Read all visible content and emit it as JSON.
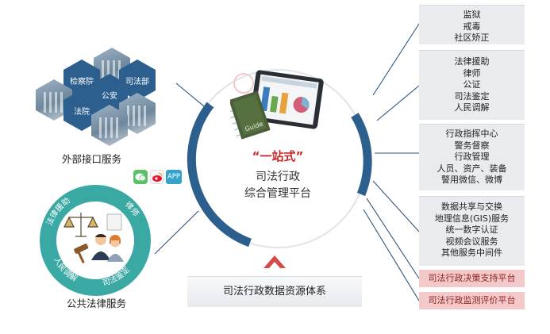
{
  "left": {
    "hex_labels": {
      "procuratorate": "检察院",
      "judicial": "司法部",
      "police": "公安",
      "court": "法院"
    },
    "external_label": "外部接口服务",
    "public_label": "公共法律服务",
    "ring_labels": {
      "legal_aid": "法律援助",
      "lawyer": "律师",
      "mediation": "人民调解",
      "appraisal": "司法鉴定"
    }
  },
  "center": {
    "slogan": "“一站式”",
    "title_line1": "司法行政",
    "title_line2": "综合管理平台",
    "book_text": "Guide"
  },
  "bottom": {
    "system_label": "司法行政数据资源体系"
  },
  "icons": {
    "app_label": "APP"
  },
  "right": {
    "box1": [
      "监狱",
      "戒毒",
      "社区矫正"
    ],
    "box2": [
      "法律援助",
      "律师",
      "公证",
      "司法鉴定",
      "人民调解"
    ],
    "box3": [
      "行政指挥中心",
      "警务督察",
      "行政管理",
      "人员、资产、装备",
      "警用微信、微博"
    ],
    "box4": [
      "数据共享与交换",
      "地理信息(GIS)服务",
      "统一数字认证",
      "视频会议服务",
      "其他服务中间件"
    ],
    "pink1": "司法行政决策支持平台",
    "pink2": "司法行政监测评价平台"
  },
  "colors": {
    "navy": "#2d5f8e",
    "teal": "#3aa9a3",
    "red": "#c62a2a",
    "pink": "#f4c9c9",
    "grey_box": "#e9ebee"
  }
}
